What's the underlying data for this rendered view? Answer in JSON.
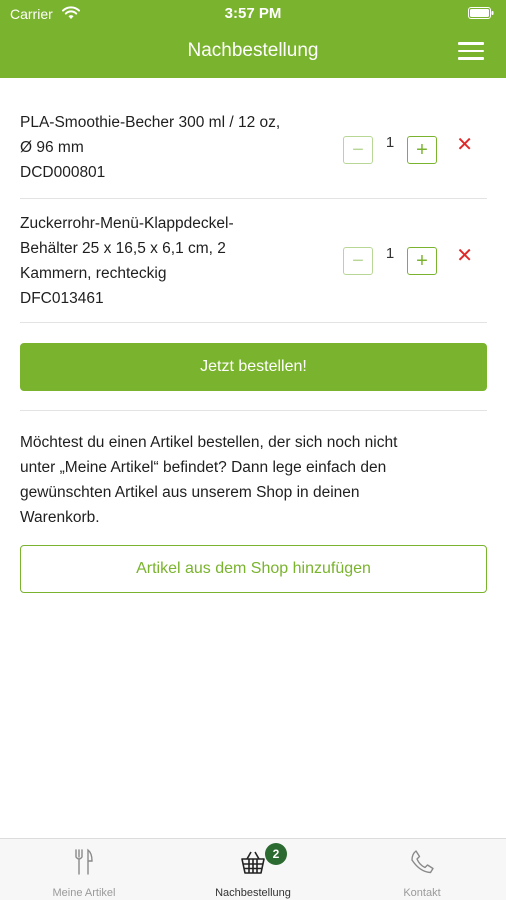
{
  "status_bar": {
    "carrier": "Carrier",
    "time": "3:57 PM"
  },
  "header": {
    "title": "Nachbestellung"
  },
  "items": [
    {
      "lines": [
        "PLA-Smoothie-Becher 300 ml / 12 oz,",
        "Ø 96 mm",
        "DCD000801"
      ],
      "quantity": "1",
      "minus": "−",
      "plus": "+",
      "remove": "✕"
    },
    {
      "lines": [
        "Zuckerrohr-Menü-Klappdeckel-",
        "Behälter 25 x 16,5 x 6,1 cm, 2",
        "Kammern, rechteckig",
        "DFC013461"
      ],
      "quantity": "1",
      "minus": "−",
      "plus": "+",
      "remove": "✕"
    }
  ],
  "order_button": "Jetzt bestellen!",
  "info_lines": [
    "Möchtest du einen Artikel bestellen, der sich noch nicht",
    "unter „Meine Artikel“ befindet? Dann lege einfach den",
    "gewünschten Artikel aus unserem Shop in deinen",
    "Warenkorb."
  ],
  "shop_button": "Artikel aus dem Shop hinzufügen",
  "tabs": [
    {
      "label": "Meine Artikel",
      "icon": "cutlery-icon"
    },
    {
      "label": "Nachbestellung",
      "icon": "basket-icon",
      "badge": "2"
    },
    {
      "label": "Kontakt",
      "icon": "phone-icon"
    }
  ],
  "colors": {
    "accent": "#7ab32e",
    "badge": "#2b6a30",
    "remove": "#e0282a"
  }
}
